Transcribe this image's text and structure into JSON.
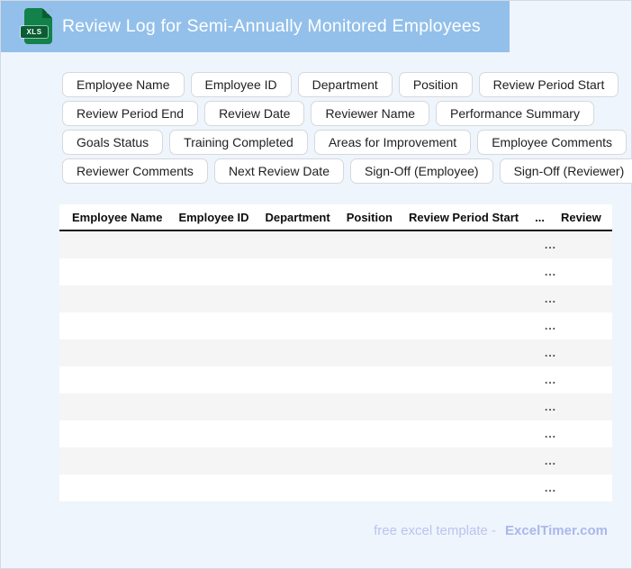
{
  "colors": {
    "banner_bg": "#93c0ea",
    "page_bg": "#eff5fc",
    "icon_green": "#12814a",
    "icon_green_dark": "#0a5c33",
    "chip_border": "#d6d8dc",
    "chip_text": "#202124",
    "table_header_text": "#0d0d0d",
    "row_stripe": "#f5f5f6",
    "footer_text": "#bac4ef",
    "footer_brand": "#a9b8ec"
  },
  "banner": {
    "title": "Review Log for Semi-Annually Monitored Employees",
    "file_badge": "XLS"
  },
  "chip_rows": [
    [
      "Employee Name",
      "Employee ID",
      "Department",
      "Position",
      "Review Period Start"
    ],
    [
      "Review Period End",
      "Review Date",
      "Reviewer Name",
      "Performance Summary"
    ],
    [
      "Goals Status",
      "Training Completed",
      "Areas for Improvement",
      "Employee Comments"
    ],
    [
      "Reviewer Comments",
      "Next Review Date",
      "Sign-Off (Employee)",
      "Sign-Off (Reviewer)"
    ]
  ],
  "table": {
    "visible_columns": [
      "Employee Name",
      "Employee ID",
      "Department",
      "Position",
      "Review Period Start",
      "...",
      "Review"
    ],
    "row_count": 10,
    "row_placeholder": "..."
  },
  "footer": {
    "label": "free excel template -",
    "brand": "ExcelTimer.com"
  }
}
